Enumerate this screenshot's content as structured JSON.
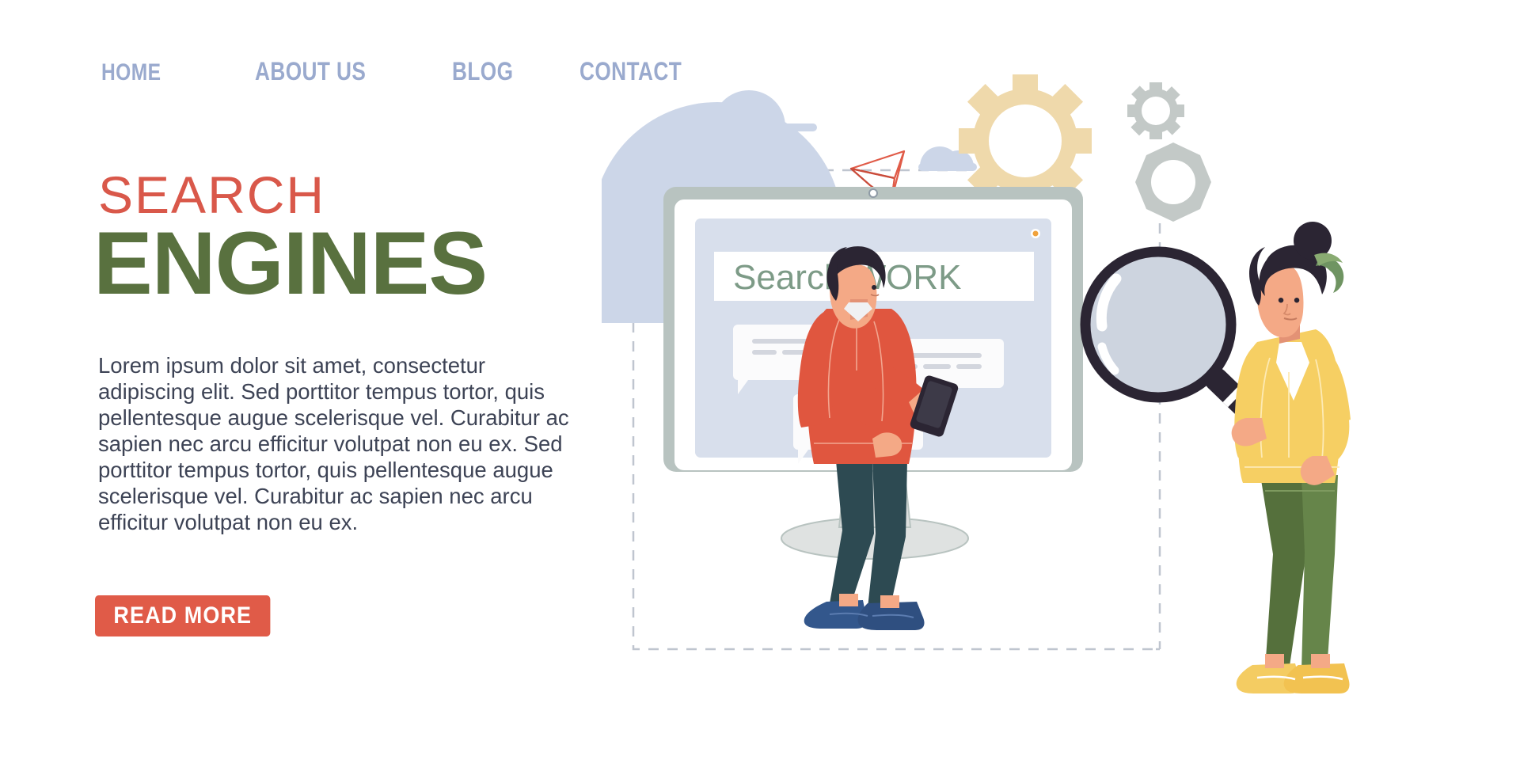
{
  "nav": {
    "items": [
      {
        "label": "HOME",
        "name": "nav-item-home"
      },
      {
        "label": "ABOUT US",
        "name": "nav-item-about-us"
      },
      {
        "label": "BLOG",
        "name": "nav-item-blog"
      },
      {
        "label": "CONTACT",
        "name": "nav-item-contact"
      }
    ]
  },
  "hero": {
    "eyebrow": "SEARCH",
    "title": "ENGINES",
    "body": "Lorem ipsum dolor sit amet, consectetur adipiscing elit. Sed porttitor tempus tortor, quis pellentesque augue scelerisque vel. Curabitur ac sapien nec arcu efficitur volutpat non eu ex. Sed porttitor tempus tortor, quis pellentesque augue scelerisque vel. Curabitur ac sapien nec arcu efficitur volutpat non eu ex.",
    "cta_label": "READ MORE"
  },
  "illustration": {
    "search_bar": {
      "value": "Search WORK",
      "placeholder": "Search WORK"
    },
    "icons": [
      "monitor-icon",
      "magnifier-icon",
      "gear-large-icon",
      "gear-small-icon",
      "nut-icon",
      "cloud-icon",
      "paper-plane-icon",
      "smartphone-icon",
      "person-man-illustration",
      "person-woman-illustration",
      "result-card",
      "dashed-frame"
    ]
  },
  "colors": {
    "accent_red": "#e05b48",
    "eyebrow_red": "#d9584a",
    "title_green": "#59713f",
    "nav_blue": "#9aaace",
    "body_text": "#3d4355",
    "search_text_green": "#7d9b87",
    "screen_panel": "#d8dfec",
    "bezel": "#b8c3c0",
    "cloud": "#ccd6e8",
    "gear_tan": "#efd9ab",
    "gear_gray": "#c3c9c7",
    "hoodie_red": "#e0563f",
    "jeans_teal": "#2d4a52",
    "blouse_yellow": "#f6cf63",
    "pants_olive": "#5f7c43",
    "shoe_blue": "#33578c",
    "shoe_yellow": "#f4cc62",
    "hair_dark": "#2b2533",
    "skin": "#f4a986"
  }
}
